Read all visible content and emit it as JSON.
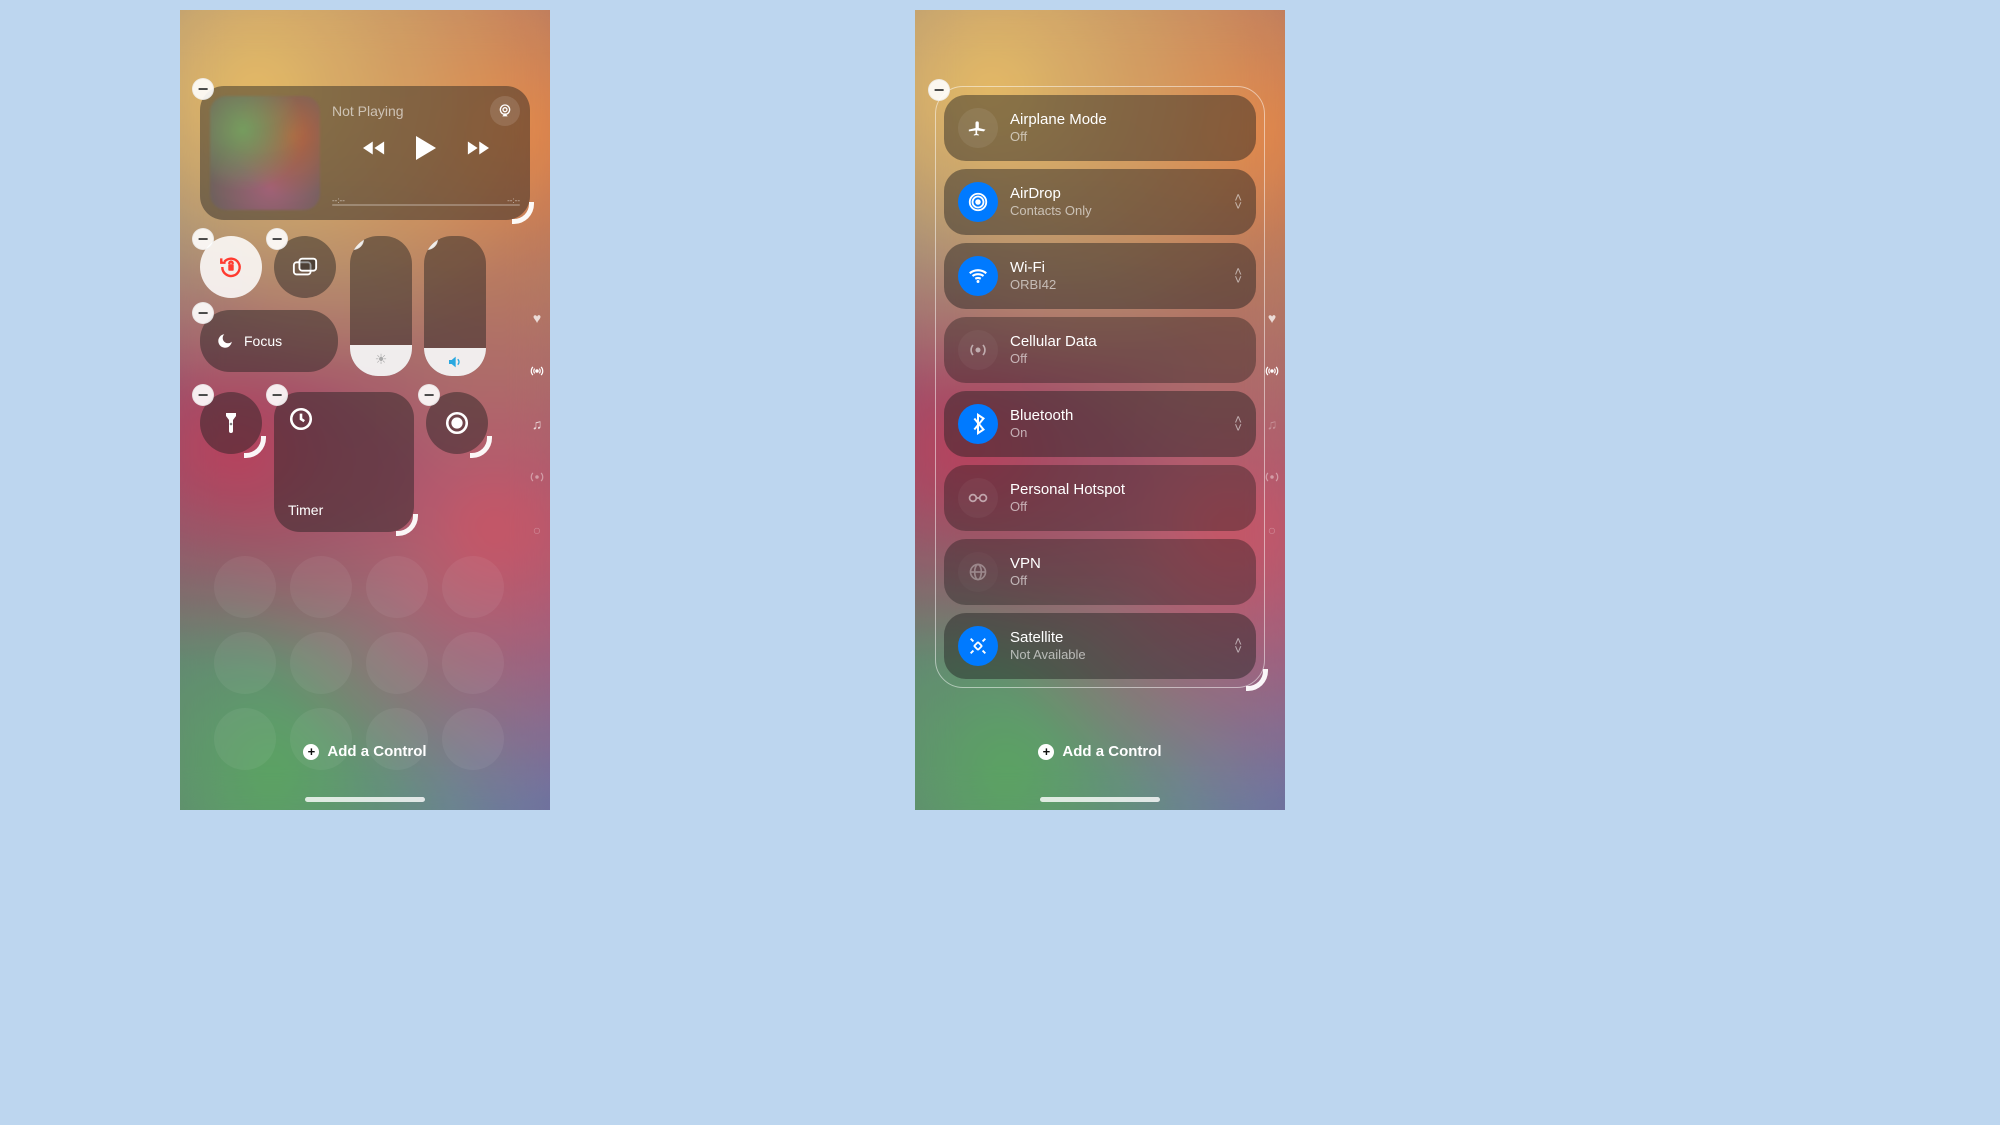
{
  "left": {
    "media": {
      "status": "Not Playing",
      "time_left": "--:--",
      "time_right": "--:--"
    },
    "focus_label": "Focus",
    "timer_label": "Timer",
    "add_control": "Add a Control"
  },
  "right": {
    "items": [
      {
        "title": "Airplane Mode",
        "sub": "Off",
        "active": false,
        "chev": false
      },
      {
        "title": "AirDrop",
        "sub": "Contacts Only",
        "active": true,
        "chev": true
      },
      {
        "title": "Wi-Fi",
        "sub": "ORBI42",
        "active": true,
        "chev": true
      },
      {
        "title": "Cellular Data",
        "sub": "Off",
        "active": false,
        "chev": false
      },
      {
        "title": "Bluetooth",
        "sub": "On",
        "active": true,
        "chev": true
      },
      {
        "title": "Personal Hotspot",
        "sub": "Off",
        "active": false,
        "chev": false
      },
      {
        "title": "VPN",
        "sub": "Off",
        "active": false,
        "chev": false
      },
      {
        "title": "Satellite",
        "sub": "Not Available",
        "active": true,
        "chev": true
      }
    ],
    "add_control": "Add a Control"
  }
}
